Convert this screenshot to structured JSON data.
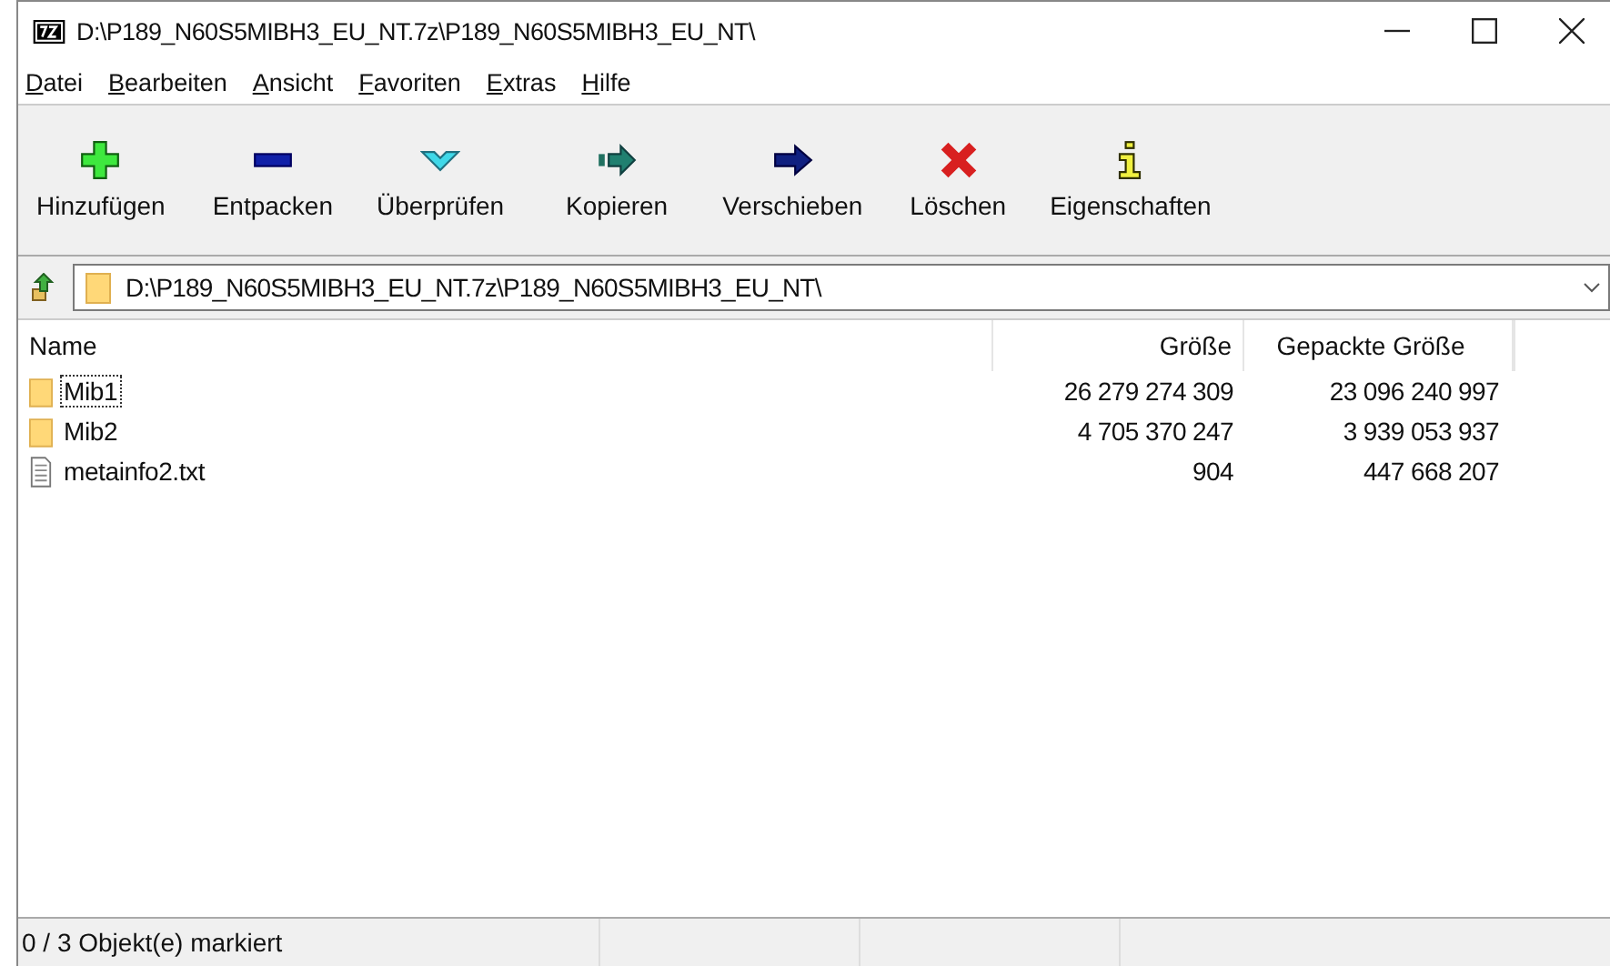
{
  "window": {
    "title": "D:\\P189_N60S5MIBH3_EU_NT.7z\\P189_N60S5MIBH3_EU_NT\\"
  },
  "menu": [
    "Datei",
    "Bearbeiten",
    "Ansicht",
    "Favoriten",
    "Extras",
    "Hilfe"
  ],
  "toolbar": [
    {
      "kind": "add",
      "label": "Hinzufügen"
    },
    {
      "kind": "extract",
      "label": "Entpacken"
    },
    {
      "kind": "test",
      "label": "Überprüfen"
    },
    {
      "kind": "copy",
      "label": "Kopieren"
    },
    {
      "kind": "move",
      "label": "Verschieben"
    },
    {
      "kind": "delete",
      "label": "Löschen"
    },
    {
      "kind": "info",
      "label": "Eigenschaften"
    }
  ],
  "address": {
    "value": "D:\\P189_N60S5MIBH3_EU_NT.7z\\P189_N60S5MIBH3_EU_NT\\"
  },
  "table": {
    "columns": [
      "Name",
      "Größe",
      "Gepackte Größe"
    ],
    "rows": [
      {
        "kind": "folder",
        "name": "Mib1",
        "size": "26 279 274 309",
        "packed": "23 096 240 997",
        "focused": true
      },
      {
        "kind": "folder",
        "name": "Mib2",
        "size": "4 705 370 247",
        "packed": "3 939 053 937",
        "focused": false
      },
      {
        "kind": "file",
        "name": "metainfo2.txt",
        "size": "904",
        "packed": "447 668 207",
        "focused": false
      }
    ]
  },
  "status_bar": "0 / 3 Objekt(e) markiert"
}
